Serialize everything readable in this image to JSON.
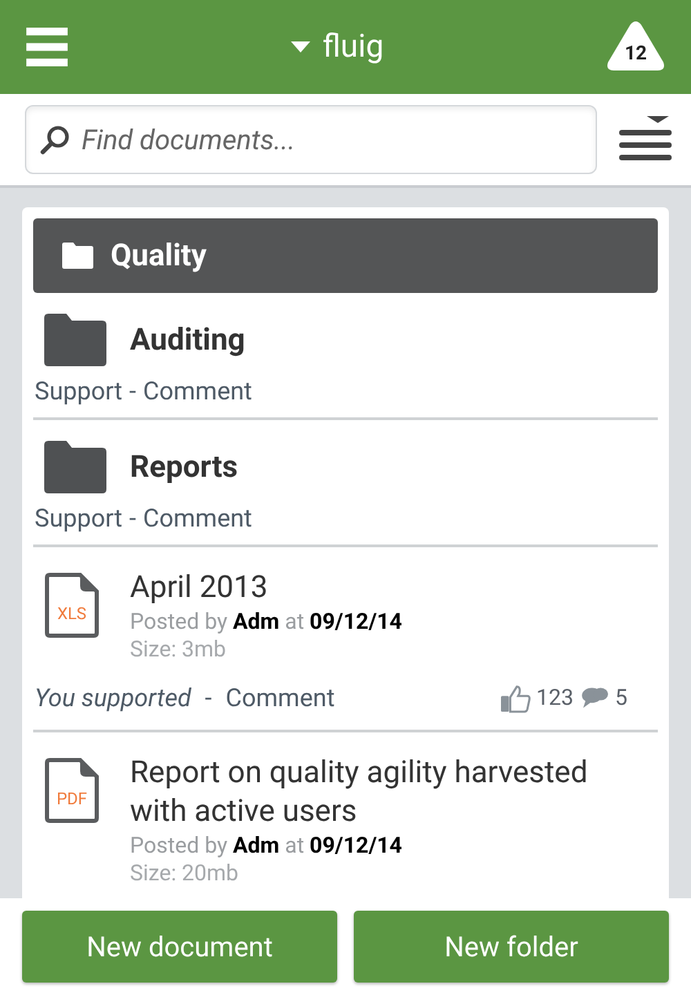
{
  "header": {
    "title": "fluig",
    "notifications": "12"
  },
  "search": {
    "placeholder": "Find documents..."
  },
  "folder": {
    "title": "Quality"
  },
  "items": [
    {
      "kind": "folder",
      "title": "Auditing",
      "support": "Support",
      "separator": "-",
      "comment": "Comment"
    },
    {
      "kind": "folder",
      "title": "Reports",
      "support": "Support",
      "separator": "-",
      "comment": "Comment"
    },
    {
      "kind": "document",
      "file_type": "XLS",
      "title": "April 2013",
      "posted": "Posted by **Adm** at **09/12/14**",
      "size": "Size: 3mb",
      "support": "You supported",
      "separator": "-",
      "comment": "Comment",
      "likes": "123",
      "comments": "5"
    },
    {
      "kind": "document",
      "file_type": "PDF",
      "title": "Report on quality agility harvested with active users",
      "posted": "Posted by **Adm** at **09/12/14**",
      "size": "Size: 20mb"
    }
  ],
  "buttons": [
    "New document",
    "New folder"
  ]
}
